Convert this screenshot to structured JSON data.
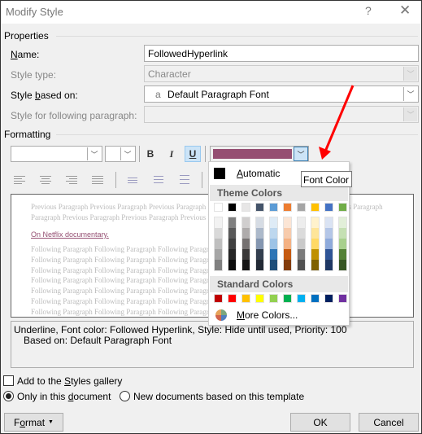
{
  "window": {
    "title": "Modify Style",
    "help": "?",
    "close": "✕"
  },
  "properties": {
    "group_label": "Properties",
    "name_label": "Name:",
    "name_value": "FollowedHyperlink",
    "style_type_label": "Style type:",
    "style_type_value": "Character",
    "based_on_label": "Style based on:",
    "based_on_icon": "a",
    "based_on_value": "Default Paragraph Font",
    "following_label": "Style for following paragraph:",
    "following_value": ""
  },
  "formatting": {
    "group_label": "Formatting",
    "font_value": "",
    "size_value": "",
    "bold": "B",
    "italic": "I",
    "underline": "U",
    "underline_active": true,
    "font_color_hex": "#954f72"
  },
  "preview": {
    "previous_lines": [
      "Previous Paragraph Previous Paragraph Previous Paragraph Previous Paragraph Previous Paragraph Previous Paragraph",
      "Paragraph Previous Paragraph Previous Paragraph Previous Paragraph Previous Paragraph Previous"
    ],
    "sample_text": "On Netflix documentary.",
    "following_line": "Following Paragraph Following Paragraph Following Paragraph Following Paragraph Following Paragraph"
  },
  "description": {
    "line1": "Underline, Font color: Followed Hyperlink, Style: Hide until used, Priority: 100",
    "line2": "Based on: Default Paragraph Font"
  },
  "options": {
    "add_gallery": "Add to the Styles gallery",
    "add_gallery_checked": false,
    "only_doc": "Only in this document",
    "new_docs": "New documents based on this template",
    "selected": "only_doc"
  },
  "buttons": {
    "format": "Format",
    "ok": "OK",
    "cancel": "Cancel"
  },
  "color_picker": {
    "automatic": "Automatic",
    "automatic_hex": "#000000",
    "theme_header": "Theme Colors",
    "theme_top": [
      "#ffffff",
      "#000000",
      "#e7e6e6",
      "#44546a",
      "#5b9bd5",
      "#ed7d31",
      "#a5a5a5",
      "#ffc000",
      "#4472c4",
      "#70ad47"
    ],
    "theme_shades": [
      [
        "#f2f2f2",
        "#d9d9d9",
        "#bfbfbf",
        "#a6a6a6",
        "#808080"
      ],
      [
        "#808080",
        "#595959",
        "#404040",
        "#262626",
        "#0d0d0d"
      ],
      [
        "#d0cece",
        "#aeabab",
        "#757171",
        "#3a3838",
        "#161616"
      ],
      [
        "#d6dce4",
        "#acb9ca",
        "#8496b0",
        "#333f4f",
        "#222a35"
      ],
      [
        "#deebf6",
        "#bdd7ee",
        "#9dc3e6",
        "#2e75b5",
        "#1f4e79"
      ],
      [
        "#fbe5d5",
        "#f7cbac",
        "#f4b183",
        "#c55a11",
        "#833c0b"
      ],
      [
        "#ededed",
        "#dbdbdb",
        "#c9c9c9",
        "#7b7b7b",
        "#525252"
      ],
      [
        "#fff2cc",
        "#fee599",
        "#ffd965",
        "#bf9000",
        "#7f6000"
      ],
      [
        "#dae3f3",
        "#b4c6e7",
        "#8eaadb",
        "#2f5496",
        "#1f3864"
      ],
      [
        "#e2efd9",
        "#c5e0b3",
        "#a8d08d",
        "#538135",
        "#375623"
      ]
    ],
    "standard_header": "Standard Colors",
    "standard": [
      "#c00000",
      "#ff0000",
      "#ffc000",
      "#ffff00",
      "#92d050",
      "#00b050",
      "#00b0f0",
      "#0070c0",
      "#002060",
      "#7030a0"
    ],
    "more": "More Colors...",
    "tooltip": "Font Color"
  },
  "annotation": {
    "arrow_color": "#ff0000"
  }
}
